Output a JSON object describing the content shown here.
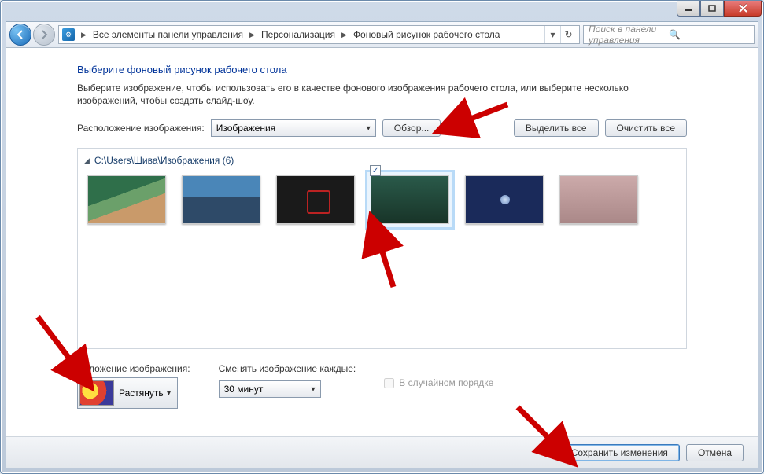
{
  "breadcrumb": {
    "seg1": "Все элементы панели управления",
    "seg2": "Персонализация",
    "seg3": "Фоновый рисунок рабочего стола"
  },
  "search": {
    "placeholder": "Поиск в панели управления"
  },
  "heading": "Выберите фоновый рисунок рабочего стола",
  "subtitle": "Выберите изображение, чтобы использовать его в качестве фонового изображения рабочего стола, или выберите несколько изображений, чтобы создать слайд-шоу.",
  "location_label": "Расположение изображения:",
  "location_value": "Изображения",
  "browse_btn": "Обзор...",
  "select_all_btn": "Выделить все",
  "clear_all_btn": "Очистить все",
  "group_header": "C:\\Users\\Шива\\Изображения (6)",
  "position": {
    "label": "Положение изображения:",
    "value": "Растянуть"
  },
  "interval": {
    "label": "Сменять изображение каждые:",
    "value": "30 минут"
  },
  "shuffle_label": "В случайном порядке",
  "save_btn": "Сохранить изменения",
  "cancel_btn": "Отмена"
}
